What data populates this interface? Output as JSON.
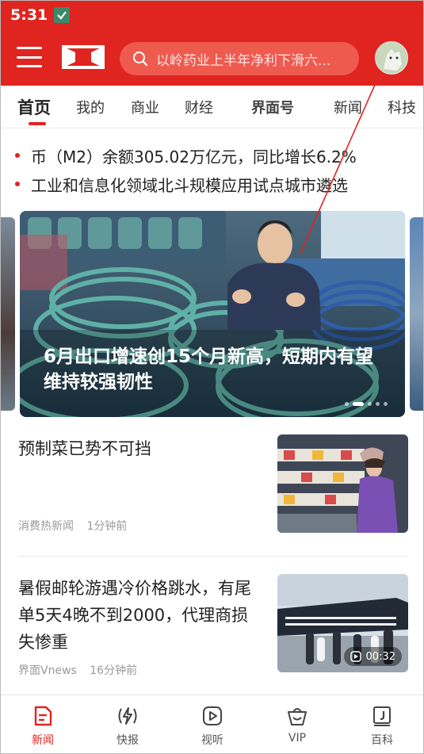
{
  "status_bar": {
    "time": "5:31"
  },
  "header": {
    "search_placeholder": "以岭药业上半年净利下滑六..."
  },
  "tabs": [
    {
      "label": "首页",
      "active": true
    },
    {
      "label": "我的"
    },
    {
      "label": "商业"
    },
    {
      "label": "财经"
    },
    {
      "label": "界面号"
    },
    {
      "label": "新闻"
    },
    {
      "label": "科技"
    }
  ],
  "ticker": [
    "币（M2）余额305.02万亿元，同比增长6.2%",
    "工业和信息化领域北斗规模应用试点城市遴选"
  ],
  "banner": {
    "title": "6月出口增速创15个月新高，短期内有望维持较强韧性",
    "pages": 5,
    "current_page": 2
  },
  "news": [
    {
      "title": "预制菜已势不可挡",
      "source": "消费热新闻",
      "time": "1分钟前"
    },
    {
      "title": "暑假邮轮游遇冷价格跳水，有尾单5天4晚不到2000，代理商损失惨重",
      "source": "界面Vnews",
      "time": "16分钟前",
      "duration": "00:32"
    }
  ],
  "bottom_nav": [
    {
      "label": "新闻",
      "icon": "news-icon",
      "active": true
    },
    {
      "label": "快报",
      "icon": "flash-icon"
    },
    {
      "label": "视听",
      "icon": "play-icon"
    },
    {
      "label": "VIP",
      "icon": "vip-icon"
    },
    {
      "label": "百科",
      "icon": "encyclopedia-icon"
    }
  ],
  "colors": {
    "brand": "#e0241f"
  }
}
